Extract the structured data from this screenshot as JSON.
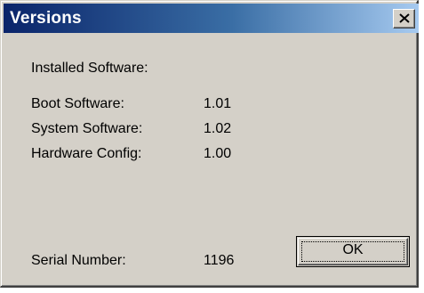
{
  "window": {
    "title": "Versions",
    "close_icon": "close-icon"
  },
  "content": {
    "heading": "Installed Software:",
    "rows": [
      {
        "label": "Boot Software:",
        "value": "1.01"
      },
      {
        "label": "System Software:",
        "value": "1.02"
      },
      {
        "label": "Hardware Config:",
        "value": "1.00"
      }
    ],
    "serial": {
      "label": "Serial Number:",
      "value": "1196"
    }
  },
  "buttons": {
    "ok_label": "OK"
  },
  "colors": {
    "titlebar_start": "#0a246a",
    "titlebar_end": "#a6caf0",
    "face": "#d4d0c8"
  }
}
